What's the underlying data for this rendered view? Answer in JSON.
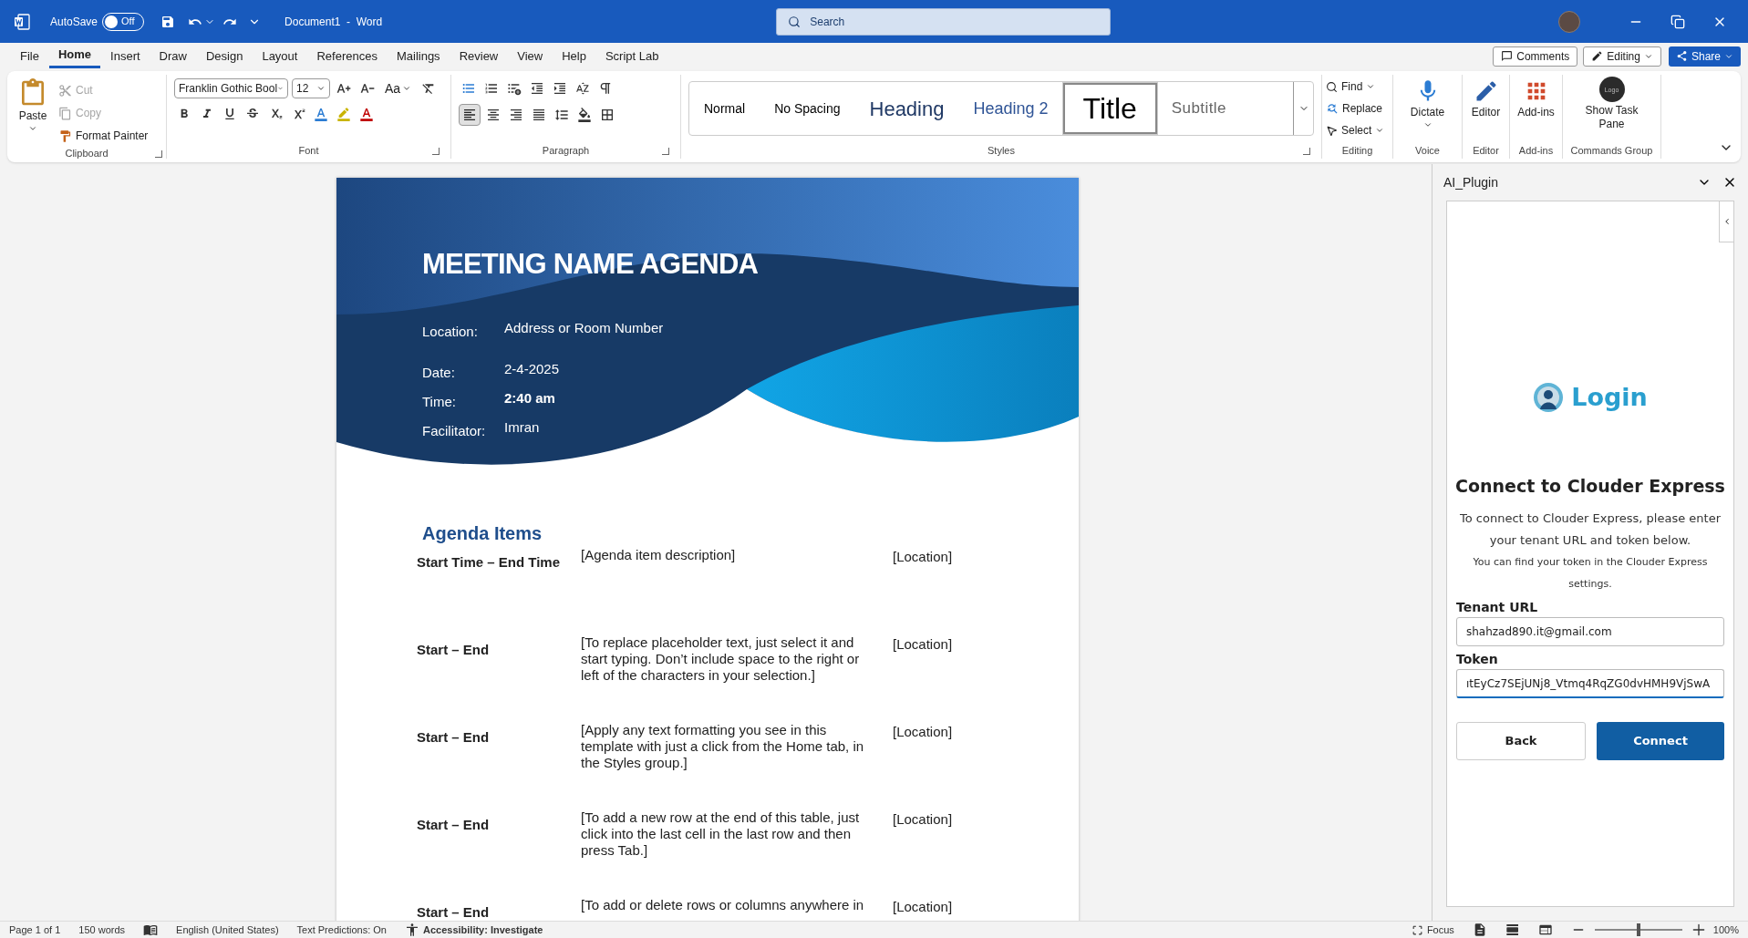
{
  "title_bar": {
    "autosave_label": "AutoSave",
    "autosave": {
      "on": false,
      "label": "Off"
    },
    "document_title": "Document1  -  Word",
    "search": {
      "placeholder": "Search"
    }
  },
  "menu_tabs": [
    {
      "label": "File",
      "selected": false
    },
    {
      "label": "Home",
      "selected": true
    },
    {
      "label": "Insert",
      "selected": false
    },
    {
      "label": "Draw",
      "selected": false
    },
    {
      "label": "Design",
      "selected": false
    },
    {
      "label": "Layout",
      "selected": false
    },
    {
      "label": "References",
      "selected": false
    },
    {
      "label": "Mailings",
      "selected": false
    },
    {
      "label": "Review",
      "selected": false
    },
    {
      "label": "View",
      "selected": false
    },
    {
      "label": "Help",
      "selected": false
    },
    {
      "label": "Script Lab",
      "selected": false
    }
  ],
  "header_buttons": {
    "comments": "Comments",
    "editing": "Editing",
    "share": "Share"
  },
  "ribbon": {
    "clipboard": {
      "label": "Clipboard",
      "paste": "Paste",
      "actions": [
        {
          "kind": "cut",
          "label": "Cut",
          "disabled": true
        },
        {
          "kind": "copy",
          "label": "Copy",
          "disabled": true
        },
        {
          "kind": "painter",
          "label": "Format Painter",
          "disabled": false
        }
      ]
    },
    "font": {
      "label": "Font",
      "font_name": "Franklin Gothic Bool",
      "size": "12",
      "change_case": "Aa"
    },
    "paragraph": {
      "label": "Paragraph"
    },
    "styles": {
      "label": "Styles",
      "items": [
        {
          "kind": "normal",
          "label": "Normal",
          "selected": false
        },
        {
          "kind": "no_spacing",
          "label": "No Spacing",
          "selected": false
        },
        {
          "kind": "heading",
          "label": "Heading",
          "selected": false
        },
        {
          "kind": "heading2",
          "label": "Heading 2",
          "selected": false
        },
        {
          "kind": "title",
          "label": "Title",
          "selected": true
        },
        {
          "kind": "subtitle",
          "label": "Subtitle",
          "selected": false
        }
      ]
    },
    "editing": {
      "label": "Editing",
      "find": "Find",
      "replace": "Replace",
      "select": "Select"
    },
    "voice": {
      "label": "Voice",
      "dictate": "Dictate"
    },
    "editor": {
      "label": "Editor",
      "button": "Editor"
    },
    "addins": {
      "label": "Add-ins",
      "button": "Add-ins"
    },
    "commands": {
      "label": "Commands Group",
      "logo": "Logo",
      "button": "Show Task Pane"
    }
  },
  "document": {
    "title": "MEETING NAME AGENDA",
    "details": [
      {
        "label": "Location:",
        "value": "Address or Room Number",
        "bold": false
      },
      {
        "label": "Date:",
        "value": "2-4-2025",
        "bold": false
      },
      {
        "label": "Time:",
        "value": "2:40 am",
        "bold": true
      },
      {
        "label": "Facilitator:",
        "value": "Imran",
        "bold": false
      }
    ],
    "agenda_heading": "Agenda Items",
    "items": [
      {
        "time": "Start Time – End Time",
        "description": "[Agenda item description]",
        "location": "[Location]"
      },
      {
        "time": "Start – End",
        "description": "[To replace placeholder text, just select it and start typing. Don’t include space to the right or left of the characters in your selection.]",
        "location": "[Location]"
      },
      {
        "time": "Start – End",
        "description": "[Apply any text formatting you see in this template with just a click from the Home tab, in the Styles group.]",
        "location": "[Location]"
      },
      {
        "time": "Start – End",
        "description": "[To add a new row at the end of this table, just click into the last cell in the last row and then press Tab.]",
        "location": "[Location]"
      },
      {
        "time": "Start – End",
        "description": "[To add or delete rows or columns anywhere in",
        "location": "[Location]"
      }
    ]
  },
  "task_pane": {
    "title": "AI_Plugin",
    "logo_text": "Login",
    "heading": "Connect to Clouder Express",
    "intro": "To connect to Clouder Express, please enter your tenant URL and token below.",
    "hint": "You can find your token in the Clouder Express settings.",
    "fields": [
      {
        "label": "Tenant URL",
        "value": "shahzad890.it@gmail.com",
        "focused": false
      },
      {
        "label": "Token",
        "value": "ıtEyCz7SEjUNj8_Vtmq4RqZG0dvHMH9VjSwA",
        "focused": true
      }
    ],
    "back": "Back",
    "connect": "Connect"
  },
  "status_bar": {
    "page": "Page 1 of 1",
    "words": "150 words",
    "language": "English (United States)",
    "predictions": "Text Predictions: On",
    "accessibility": "Accessibility: Investigate",
    "focus": "Focus",
    "zoom": {
      "level": 0.5,
      "label": "100%"
    }
  }
}
